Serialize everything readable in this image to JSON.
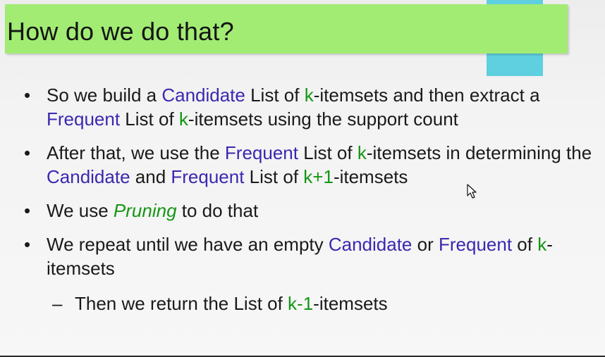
{
  "title": "How do we do that?",
  "colors": {
    "title_bar": "#a2ec74",
    "accent_bar": "#5fd0e0",
    "blue_text": "#3a28b0",
    "green_text": "#149614"
  },
  "bullet_symbol": "•",
  "sub_bullet_symbol": "–",
  "bullets": [
    {
      "segments": [
        "So we build a ",
        "Candidate",
        " List of ",
        "k",
        "-itemsets and then extract a ",
        "Frequent",
        " List of ",
        "k",
        "-itemsets using the support count"
      ]
    },
    {
      "segments": [
        "After that, we use the ",
        "Frequent",
        " List of ",
        "k",
        "-itemsets in determining the ",
        "Candidate",
        " and ",
        "Frequent",
        " List of ",
        "k+1",
        "-itemsets"
      ]
    },
    {
      "segments": [
        "We use ",
        "Pruning",
        " to do that"
      ]
    },
    {
      "segments": [
        "We repeat until we have an empty ",
        "Candidate",
        " or ",
        "Frequent",
        " of ",
        "k",
        "-itemsets"
      ]
    }
  ],
  "sub_bullets": [
    {
      "segments": [
        "Then we return the List of ",
        "k-1",
        "-itemsets"
      ]
    }
  ],
  "cursor_icon": "mouse-pointer-icon"
}
